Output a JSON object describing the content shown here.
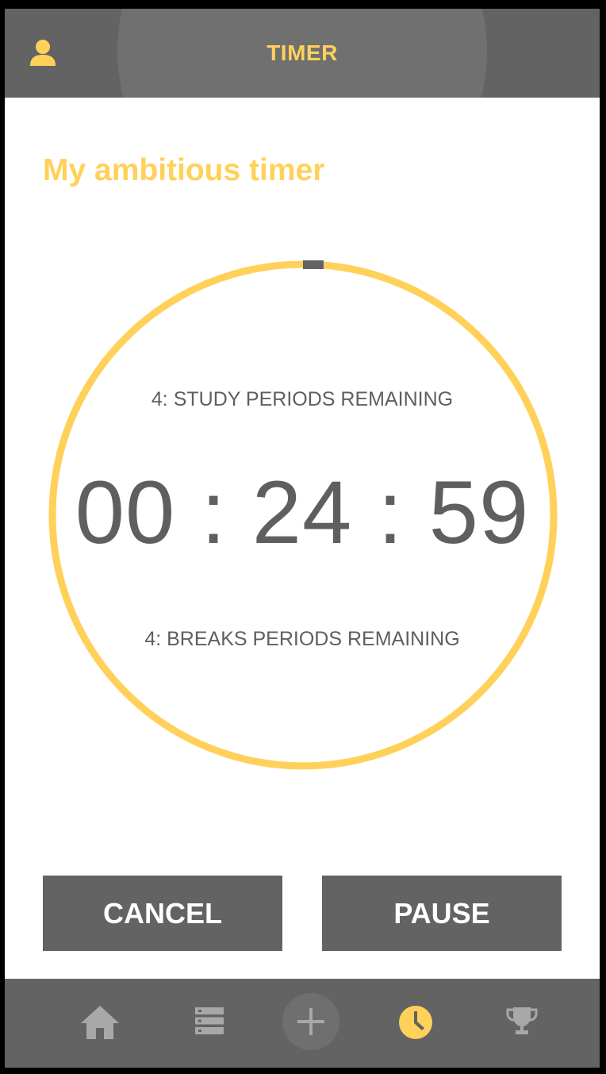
{
  "header": {
    "title": "TIMER",
    "profile_icon": "user-icon"
  },
  "timer": {
    "name": "My ambitious timer",
    "study_remaining": "4: STUDY PERIODS REMAINING",
    "hours": "00",
    "minutes": "24",
    "seconds": "59",
    "separator": ":",
    "breaks_remaining": "4: BREAKS PERIODS REMAINING"
  },
  "actions": {
    "cancel_label": "CANCEL",
    "pause_label": "PAUSE"
  },
  "nav": {
    "items": [
      {
        "icon": "home-icon",
        "active": false
      },
      {
        "icon": "list-icon",
        "active": false
      },
      {
        "icon": "add-icon",
        "active": false
      },
      {
        "icon": "clock-icon",
        "active": true
      },
      {
        "icon": "trophy-icon",
        "active": false
      }
    ]
  },
  "colors": {
    "accent": "#ffd15a",
    "dark_gray": "#636363",
    "text_gray": "#5f5f5f",
    "icon_inactive": "#a8a8a8"
  }
}
